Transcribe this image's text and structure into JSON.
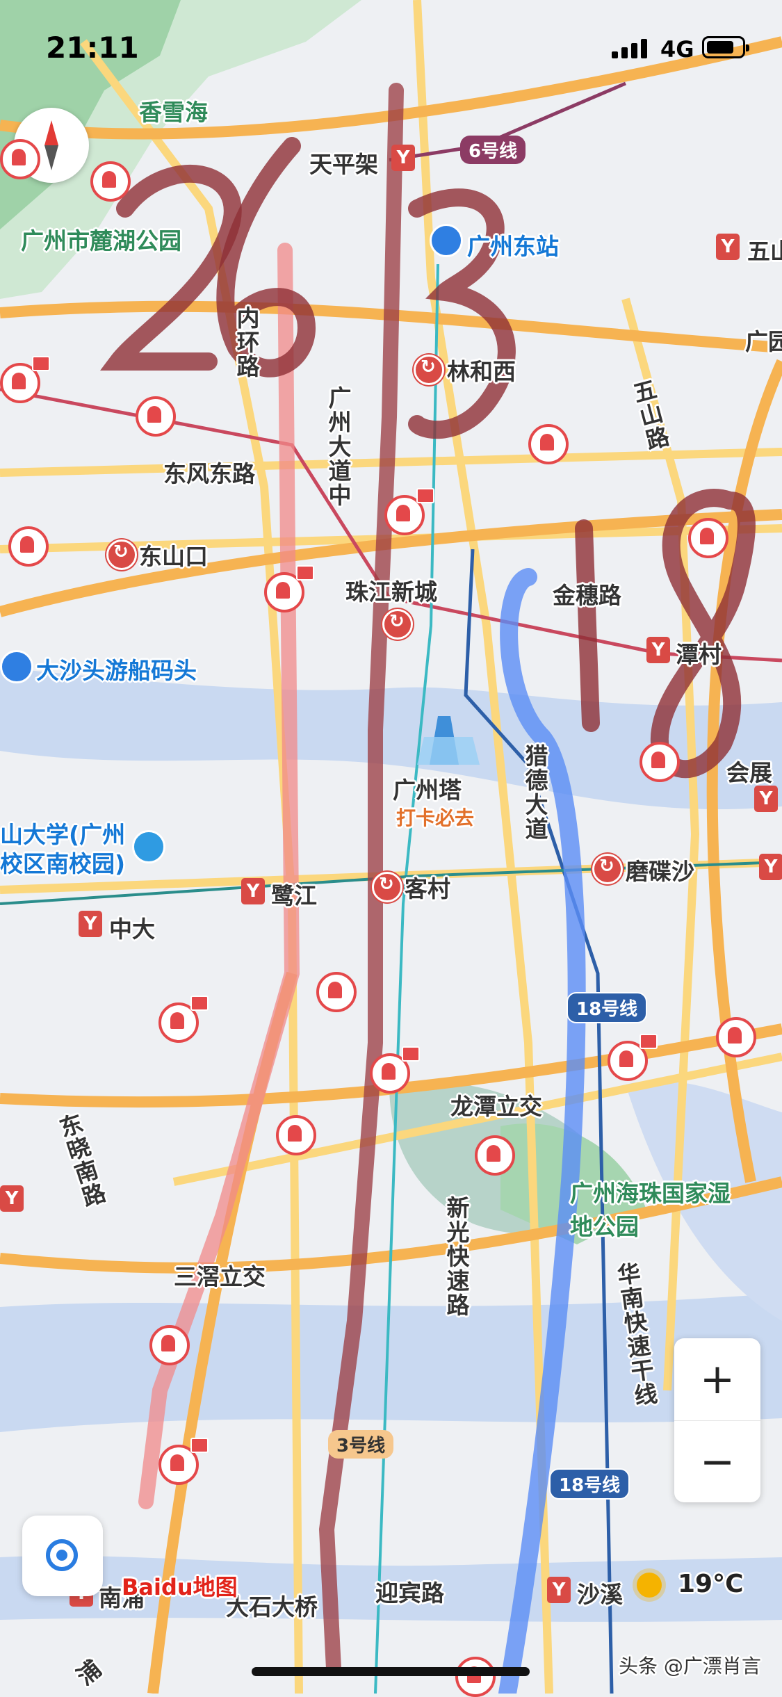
{
  "status_bar": {
    "time": "21:11",
    "network": "4G"
  },
  "map": {
    "parks": [
      "香雪海",
      "广州市麓湖公园",
      "广州海珠国家湿地公园"
    ],
    "roads": [
      "内环路",
      "广州大道中",
      "五山路",
      "东风东路",
      "金穗路",
      "猎德大道",
      "龙潭立交",
      "东晓南路",
      "新光快速路",
      "三滘立交",
      "华南快速干线",
      "迎宾路",
      "大石大桥",
      "浦"
    ],
    "metro_stations": [
      "天平架",
      "五山",
      "广园",
      "潭村",
      "会展",
      "鹭江",
      "中大",
      "磨碟沙",
      "南浦",
      "沙溪"
    ],
    "interchanges": [
      "林和西",
      "东山口",
      "珠江新城",
      "客村"
    ],
    "transit_poi": [
      "广州东站",
      "大沙头游船码头"
    ],
    "school": "山大学(广州校区南校园)",
    "landmark": {
      "name": "广州塔",
      "tag": "打卡必去"
    },
    "line_badges": [
      "6号线",
      "18号线",
      "3号线",
      "18号线"
    ]
  },
  "annotations": {
    "left_number": "263",
    "right_number": "18"
  },
  "controls": {
    "zoom_in": "+",
    "zoom_out": "−"
  },
  "branding": {
    "logo": "Baidu地图"
  },
  "weather": {
    "temperature": "19°C"
  },
  "watermark": "头条 @广漂肖言",
  "colors": {
    "river": "#c9d9f1",
    "park": "#cfe8d3",
    "expressway": "#f6b352",
    "arterial": "#fbd77d",
    "red_marker": "#d94a45",
    "blue_route": "#5b8df5"
  }
}
